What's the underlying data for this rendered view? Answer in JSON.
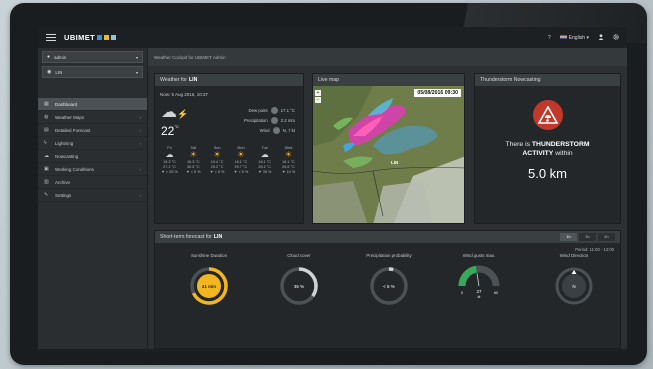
{
  "topbar": {
    "logo": "UBIMET",
    "help": "?",
    "language": "English",
    "language_caret": "▾",
    "user_icon": "user-icon",
    "settings_icon": "gear-icon"
  },
  "sidebar": {
    "user_select": "admin",
    "location_select": "LIN",
    "items": [
      {
        "label": "Dashboard",
        "icon": "grid-icon",
        "arrow": ""
      },
      {
        "label": "Weather Maps",
        "icon": "globe-icon",
        "arrow": "›"
      },
      {
        "label": "Detailed Forecast",
        "icon": "table-icon",
        "arrow": "›"
      },
      {
        "label": "Lightning",
        "icon": "bolt-icon",
        "arrow": "›"
      },
      {
        "label": "Nowcasting",
        "icon": "cloud-icon",
        "arrow": ""
      },
      {
        "label": "Working Conditions",
        "icon": "briefcase-icon",
        "arrow": "›"
      },
      {
        "label": "Archive",
        "icon": "archive-icon",
        "arrow": ""
      },
      {
        "label": "Settings",
        "icon": "wrench-icon",
        "arrow": "›"
      }
    ]
  },
  "breadcrumb": "Weather Cockpit for UBIMET Admin",
  "weather": {
    "title": "Weather for",
    "location": "LIN",
    "now": "Now: 5 Aug 2016, 10:37",
    "temp": "22",
    "temp_unit": "°C",
    "details": [
      {
        "label": "Dew point",
        "icon": "thermometer-icon",
        "value": "17.1 °C"
      },
      {
        "label": "Precipitation",
        "icon": "drop-icon",
        "value": "2.2 mm"
      },
      {
        "label": "Wind",
        "icon": "wind-icon",
        "value": "N, 7 kt"
      }
    ],
    "days": [
      {
        "name": "Fri",
        "icon": "cloud-sun-icon",
        "sym": "☁",
        "cls": "cl",
        "t1": "19.3 °C",
        "t2": "27.1 °C",
        "w": "▼ < 05 %"
      },
      {
        "name": "Sat",
        "icon": "sun-icon",
        "sym": "☀",
        "cls": "",
        "t1": "16.3 °C",
        "t2": "30.5 °C",
        "w": "▼ < 5 %"
      },
      {
        "name": "Sun",
        "icon": "sun-icon",
        "sym": "☀",
        "cls": "",
        "t1": "19.4 °C",
        "t2": "29.2 °C",
        "w": "▼ < 5 %"
      },
      {
        "name": "Mon",
        "icon": "sun-icon",
        "sym": "☀",
        "cls": "",
        "t1": "18.1 °C",
        "t2": "29.7 °C",
        "w": "▼ < 5 %"
      },
      {
        "name": "Tue",
        "icon": "cloud-sun-icon",
        "sym": "☁",
        "cls": "cl",
        "t1": "18.1 °C",
        "t2": "25.2 °C",
        "w": "▼ 35 %"
      },
      {
        "name": "Wed",
        "icon": "sun-icon",
        "sym": "☀",
        "cls": "",
        "t1": "16.1 °C",
        "t2": "25.6 °C",
        "w": "▼ 10 %"
      }
    ]
  },
  "map": {
    "title": "Live map",
    "timestamp": "05/08/2016 09:30",
    "zoom_in": "+",
    "zoom_out": "−",
    "location_label": "LIN"
  },
  "thunderstorm": {
    "title": "Thunderstorm Nowcasting",
    "line1": "There is",
    "highlight": "THUNDERSTORM",
    "line2": "ACTIVITY",
    "line2_suffix": "within",
    "distance": "5.0 km"
  },
  "short_term": {
    "title": "Short-term forecast for",
    "location": "LIN",
    "tabs": [
      "1h",
      "3h",
      "6h"
    ],
    "active_tab": 0,
    "period": "Period: 11:00 - 12:00",
    "gauges": [
      {
        "label": "Sunshine Duration",
        "value": "41 min",
        "fraction": 0.68,
        "color": "#f2b61e"
      },
      {
        "label": "Cloud cover",
        "value": "35 %",
        "fraction": 0.35,
        "color": "#cfd3d5"
      },
      {
        "label": "Precipitation probability",
        "value": "< 5 %",
        "fraction": 0.04,
        "color": "#cfd3d5"
      },
      {
        "label": "Wind gusts max.",
        "value": "27",
        "unit": "kt",
        "min": "0",
        "max": "60",
        "fraction": 0.45,
        "color": "#3aa85b"
      },
      {
        "label": "Wind Direction",
        "value": "N",
        "color": "#cfd3d5"
      }
    ]
  },
  "colors": {
    "accent_red": "#c0392b",
    "sun_yellow": "#f2b61e",
    "gust_green": "#3aa85b"
  }
}
